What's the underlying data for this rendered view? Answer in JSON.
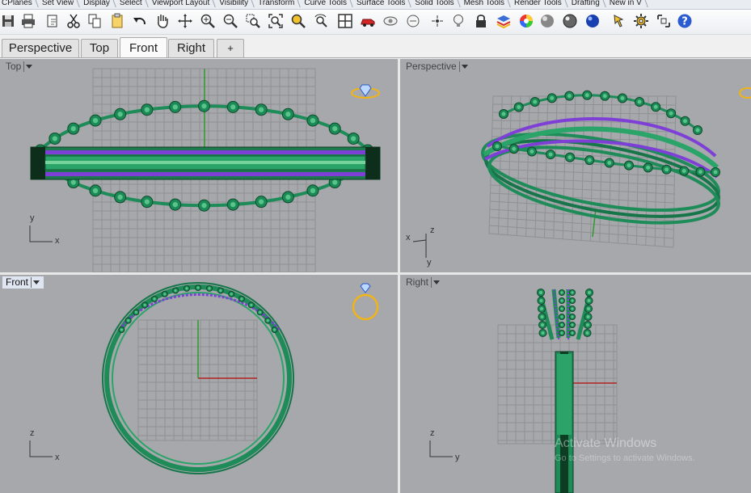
{
  "toolbar_tabs": [
    "CPlanes",
    "Set View",
    "Display",
    "Select",
    "Viewport Layout",
    "Visibility",
    "Transform",
    "Curve Tools",
    "Surface Tools",
    "Solid Tools",
    "Mesh Tools",
    "Render Tools",
    "Drafting",
    "New in V"
  ],
  "toolbar_icons": [
    "save-icon",
    "print-icon",
    "new-icon",
    "cut-icon",
    "copy-icon",
    "paste-icon",
    "undo-icon",
    "pan-hand-icon",
    "move-view-icon",
    "zoom-in-icon",
    "zoom-out-icon",
    "zoom-window-icon",
    "zoom-extents-icon",
    "zoom-selected-icon",
    "rotate-view-icon",
    "four-viewports-icon",
    "car-icon",
    "hide-icon",
    "ghosted-icon",
    "bulb-icon",
    "lock-icon",
    "layer-icon",
    "color-wheel-icon",
    "shaded-sphere-icon",
    "rendered-sphere-icon",
    "blue-sphere-icon",
    "pointer-icon",
    "gear-icon",
    "named-views-icon",
    "help-icon"
  ],
  "viewport_tabs": [
    "Perspective",
    "Top",
    "Front",
    "Right",
    "+"
  ],
  "active_tab": "Front",
  "viewports": {
    "top": {
      "label": "Top",
      "axis_v": "y",
      "axis_h": "x"
    },
    "persp": {
      "label": "Perspective",
      "axis_v": "z",
      "axis_h": "x",
      "axis_d": "y"
    },
    "front": {
      "label": "Front",
      "axis_v": "z",
      "axis_h": "x"
    },
    "right": {
      "label": "Right",
      "axis_v": "z",
      "axis_h": "y"
    }
  },
  "watermark": {
    "line1": "Activate Windows",
    "line2": "Go to Settings to activate Windows."
  },
  "colors": {
    "viewport_bg": "#a6a8ab",
    "grid": "#8f9194",
    "model_green": "#1f9a62",
    "gem_purple": "#8a2be2",
    "axis_x": "#b22222",
    "axis_y": "#2e8b2e"
  }
}
